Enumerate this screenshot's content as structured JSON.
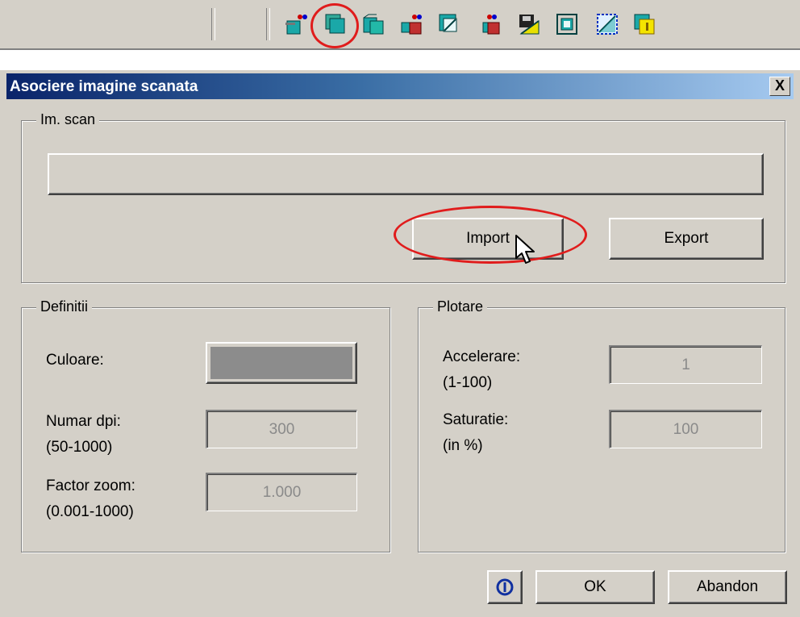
{
  "toolbar": {
    "icons": [
      "scan-insert-icon",
      "scan-associate-icon",
      "scan-open-icon",
      "scan-delete-icon",
      "scan-edit-icon",
      "scan-remove-icon",
      "scan-save-icon",
      "scan-frame-icon",
      "scan-crop-icon",
      "scan-info-icon"
    ],
    "highlight_color": "#e01c1c"
  },
  "dialog": {
    "title": "Asociere imagine scanata",
    "close_label": "X",
    "im_scan": {
      "group_label": "Im. scan",
      "path_value": "",
      "import_label": "Import",
      "export_label": "Export"
    },
    "definitii": {
      "group_label": "Definitii",
      "culoare_label": "Culoare:",
      "culoare_color": "#8c8c8c",
      "dpi_label": "Numar dpi:",
      "dpi_range": "(50-1000)",
      "dpi_value": "300",
      "zoom_label": "Factor zoom:",
      "zoom_range": "(0.001-1000)",
      "zoom_value": "1.000"
    },
    "plotare": {
      "group_label": "Plotare",
      "accelerare_label": "Accelerare:",
      "accelerare_range": "(1-100)",
      "accelerare_value": "1",
      "saturatie_label": "Saturatie:",
      "saturatie_range": "(in %)",
      "saturatie_value": "100"
    },
    "footer": {
      "help_icon": "info-icon",
      "ok_label": "OK",
      "cancel_label": "Abandon"
    },
    "title_gradient": [
      "#0a246a",
      "#a6caf0"
    ]
  }
}
